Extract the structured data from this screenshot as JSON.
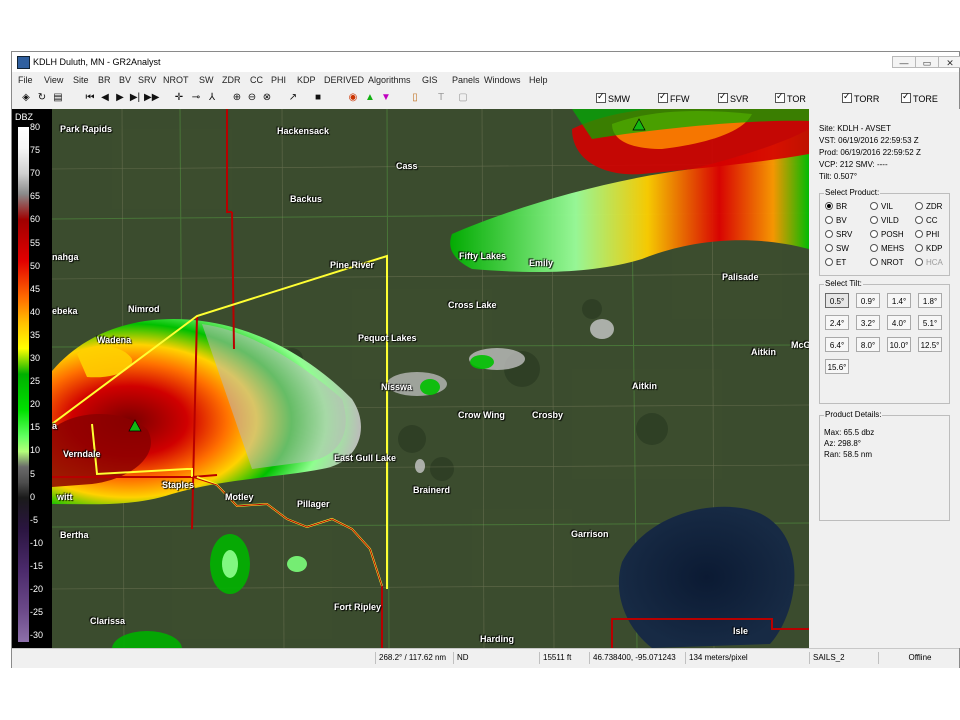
{
  "window": {
    "title": "KDLH Duluth, MN - GR2Analyst",
    "minimize": "—",
    "restore": "▭",
    "close": "✕"
  },
  "menu": [
    "File",
    "View",
    "Site",
    "BR",
    "BV",
    "SRV",
    "NROT",
    "SW",
    "ZDR",
    "CC",
    "PHI",
    "KDP",
    "DERIVED",
    "Algorithms",
    "GIS",
    "Panels",
    "Windows",
    "Help"
  ],
  "toolbar": {
    "icons": [
      "satellite-icon",
      "refresh-icon",
      "folder-icon",
      "skip-first-icon",
      "step-back-icon",
      "play-icon",
      "step-forward-icon",
      "skip-last-icon",
      "crosshair-icon",
      "measure-icon",
      "distance-icon",
      "zoom-in-icon",
      "zoom-out-icon",
      "zoom-reset-icon",
      "cursor-icon",
      "stop-icon",
      "storm-icon",
      "green-triangle-icon",
      "magenta-triangle-icon",
      "notes-icon",
      "text-icon",
      "frame-icon"
    ],
    "glyphs": [
      "◈",
      "↻",
      "▤",
      "⏮",
      "◀",
      "▶",
      "▶|",
      "▶▶",
      "✛",
      "⊸",
      "⅄",
      "⊕",
      "⊖",
      "⊗",
      "↗",
      "■",
      "◉",
      "▲",
      "▼",
      "▯",
      "T",
      "▢"
    ],
    "warnings": [
      "SMW",
      "FFW",
      "SVR",
      "TOR",
      "TORR",
      "TORE"
    ]
  },
  "scale": {
    "title": "DBZ",
    "ticks": [
      "80",
      "75",
      "70",
      "65",
      "60",
      "55",
      "50",
      "45",
      "40",
      "35",
      "30",
      "25",
      "20",
      "15",
      "10",
      "5",
      "0",
      "-5",
      "-10",
      "-15",
      "-20",
      "-25",
      "-30"
    ]
  },
  "places": [
    {
      "name": "Park Rapids"
    },
    {
      "name": "Hackensack"
    },
    {
      "name": "Cass"
    },
    {
      "name": "Backus"
    },
    {
      "name": "nahga"
    },
    {
      "name": "Fifty Lakes"
    },
    {
      "name": "Emily"
    },
    {
      "name": "Pine River"
    },
    {
      "name": "Palisade"
    },
    {
      "name": "Cross Lake"
    },
    {
      "name": "ebeka"
    },
    {
      "name": "Nimrod"
    },
    {
      "name": "Wadena"
    },
    {
      "name": "Pequot Lakes"
    },
    {
      "name": "Aitkin"
    },
    {
      "name": "McG"
    },
    {
      "name": "Nisswa"
    },
    {
      "name": "Aitkin"
    },
    {
      "name": "Crow Wing"
    },
    {
      "name": "Crosby"
    },
    {
      "name": "a"
    },
    {
      "name": "Verndale"
    },
    {
      "name": "East Gull Lake"
    },
    {
      "name": "Staples"
    },
    {
      "name": "Motley"
    },
    {
      "name": "witt"
    },
    {
      "name": "Pillager"
    },
    {
      "name": "Brainerd"
    },
    {
      "name": "Garrison"
    },
    {
      "name": "Bertha"
    },
    {
      "name": "Fort Ripley"
    },
    {
      "name": "Clarissa"
    },
    {
      "name": "Harding"
    },
    {
      "name": "Isle"
    }
  ],
  "info": {
    "site": "Site:  KDLH - AVSET",
    "vst": "VST:   06/19/2016  22:59:53 Z",
    "prod": "Prod:  06/19/2016  22:59:52 Z",
    "vcp": "VCP:   212          SMV:   ----",
    "tilt": "Tilt:   0.507°"
  },
  "select_product": {
    "title": "Select Product:",
    "selected": "BR",
    "options": [
      "BR",
      "VIL",
      "ZDR",
      "BV",
      "VILD",
      "CC",
      "SRV",
      "POSH",
      "PHI",
      "SW",
      "MEHS",
      "KDP",
      "ET",
      "NROT",
      "HCA"
    ],
    "disabled": [
      "HCA"
    ]
  },
  "select_tilt": {
    "title": "Select Tilt:",
    "selected": "0.5°",
    "options": [
      "0.5°",
      "0.9°",
      "1.4°",
      "1.8°",
      "2.4°",
      "3.2°",
      "4.0°",
      "5.1°",
      "6.4°",
      "8.0°",
      "10.0°",
      "12.5°",
      "15.6°"
    ]
  },
  "product_details": {
    "title": "Product Details:",
    "max": "Max: 65.5 dbz",
    "az": "Az:  298.8°",
    "ran": "Ran: 58.5 nm"
  },
  "status": {
    "azimuth": "268.2° / 117.62 nm",
    "value": "ND",
    "height": "15511 ft",
    "latlon": "46.738400, -95.071243",
    "resolution": "134 meters/pixel",
    "mode": "SAILS_2",
    "state": "Offline"
  },
  "colors": {
    "accent": "#ff0000",
    "county_line": "#b80000",
    "warning_poly": "#ffff33"
  }
}
